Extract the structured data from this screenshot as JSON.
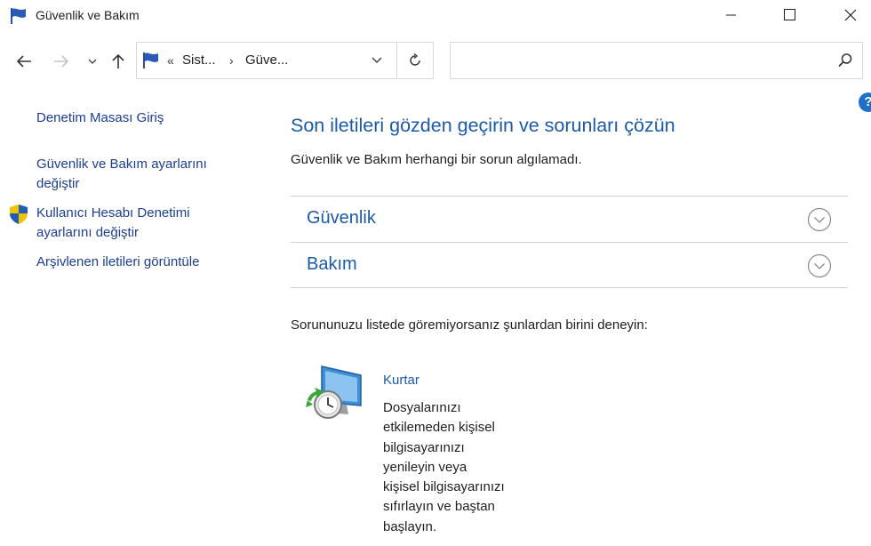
{
  "window": {
    "title": "Güvenlik ve Bakım",
    "controls": [
      "minimize",
      "maximize",
      "close"
    ]
  },
  "nav": {
    "back_icon": "back-arrow-icon",
    "forward_icon": "forward-arrow-icon",
    "recent_icon": "chevron-down-icon",
    "up_icon": "up-arrow-icon"
  },
  "address": {
    "overflow": "«",
    "crumbs": [
      "Sist...",
      "Güve..."
    ]
  },
  "search": {
    "placeholder": ""
  },
  "sidebar": {
    "items": [
      {
        "label": "Denetim Masası Giriş"
      },
      {
        "label": "Güvenlik ve Bakım ayarlarını\ndeğiştir"
      },
      {
        "label": "Kullanıcı Hesabı Denetimi\nayarlarını değiştir",
        "icon": "uac-shield-icon"
      },
      {
        "label": "Arşivlenen iletileri görüntüle"
      }
    ]
  },
  "main": {
    "heading": "Son iletileri gözden geçirin ve sorunları çözün",
    "status": "Güvenlik ve Bakım herhangi bir sorun algılamadı.",
    "sections": [
      {
        "label": "Güvenlik"
      },
      {
        "label": "Bakım"
      }
    ],
    "try_text": "Sorununuzu listede göremiyorsanız şunlardan birini deneyin:",
    "recovery": {
      "link": "Kurtar",
      "description": "Dosyalarınızı\netkilemeden kişisel\nbilgisayarınızı\nyenileyin veya\nkişisel bilgisayarınızı\nsıfırlayın ve baştan\nbaşlayın."
    }
  },
  "help_label": "?",
  "colors": {
    "link": "#1a3e92",
    "heading": "#1b5aa8",
    "help": "#1f6fc5"
  }
}
